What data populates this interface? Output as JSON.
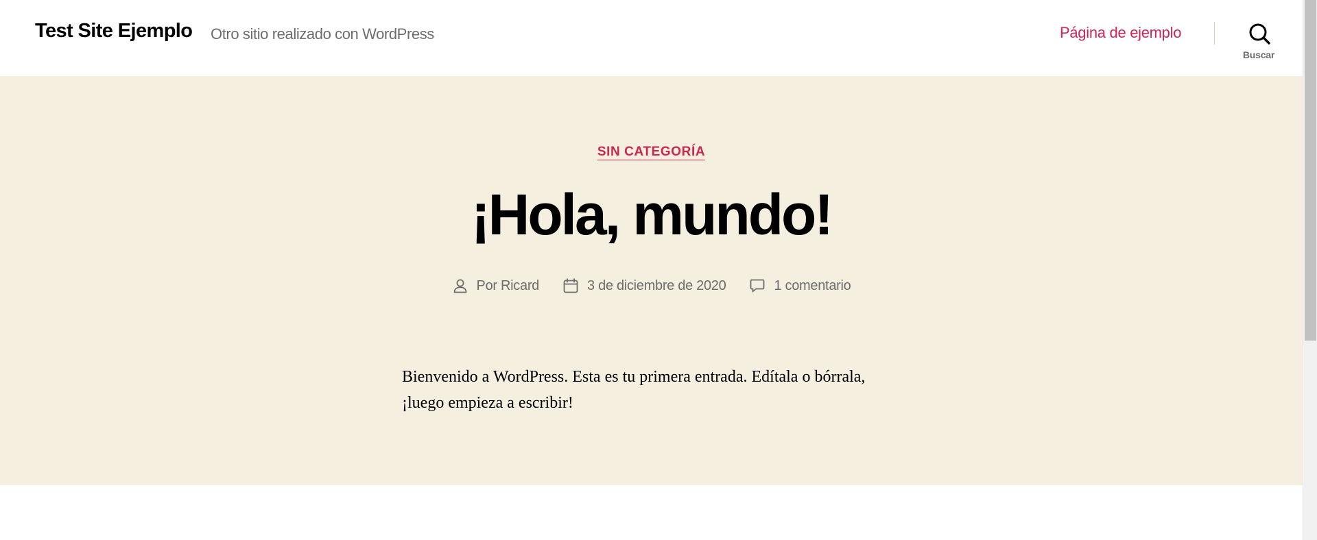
{
  "header": {
    "site_title": "Test Site Ejemplo",
    "site_description": "Otro sitio realizado con WordPress",
    "menu_item": "Página de ejemplo",
    "search_label": "Buscar"
  },
  "post": {
    "category": "SIN CATEGORÍA",
    "title": "¡Hola, mundo!",
    "author": "Por Ricard",
    "date": "3 de diciembre de 2020",
    "comments": "1 comentario",
    "content_line1": "Bienvenido a WordPress. Esta es tu primera entrada. Edítala o bórrala,",
    "content_line2": "¡luego empieza a escribir!"
  },
  "icons": {
    "search": "search-icon",
    "author": "user-icon",
    "date": "calendar-icon",
    "comments": "comment-icon"
  },
  "colors": {
    "accent": "#cd2653",
    "hero_background": "#f5efe0",
    "meta_text": "#6d6d6d",
    "text": "#000000"
  }
}
